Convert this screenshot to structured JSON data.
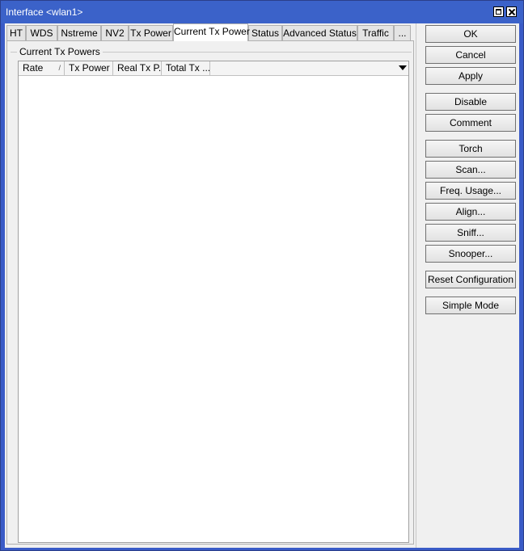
{
  "window": {
    "title": "Interface <wlan1>"
  },
  "tabs": [
    {
      "label": "HT",
      "active": false
    },
    {
      "label": "WDS",
      "active": false
    },
    {
      "label": "Nstreme",
      "active": false
    },
    {
      "label": "NV2",
      "active": false
    },
    {
      "label": "Tx Power",
      "active": false
    },
    {
      "label": "Current Tx Power",
      "active": true
    },
    {
      "label": "Status",
      "active": false
    },
    {
      "label": "Advanced Status",
      "active": false
    },
    {
      "label": "Traffic",
      "active": false
    },
    {
      "label": "...",
      "active": false
    }
  ],
  "panel": {
    "group_label": "Current Tx Powers",
    "columns": [
      "Rate",
      "Tx Power",
      "Real Tx P...",
      "Total Tx ..."
    ],
    "sort_icon": "/",
    "rows": []
  },
  "buttons": {
    "ok": "OK",
    "cancel": "Cancel",
    "apply": "Apply",
    "disable": "Disable",
    "comment": "Comment",
    "torch": "Torch",
    "scan": "Scan...",
    "freq_usage": "Freq. Usage...",
    "align": "Align...",
    "sniff": "Sniff...",
    "snooper": "Snooper...",
    "reset_configuration": "Reset Configuration",
    "simple_mode": "Simple Mode"
  },
  "icons": {
    "maximize": "maximize-icon",
    "close": "close-icon",
    "column_menu": "chevron-down-icon"
  },
  "colors": {
    "titlebar": "#3b62c9",
    "title_text": "#ffffff",
    "panel_bg": "#f0f0f0"
  }
}
